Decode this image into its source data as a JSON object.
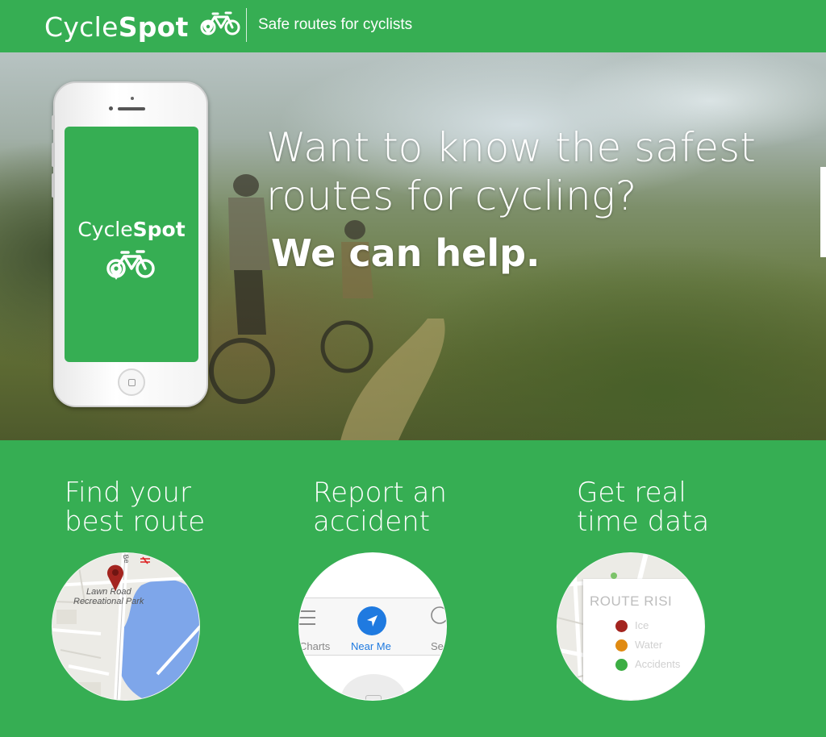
{
  "header": {
    "brand_light": "Cycle",
    "brand_bold": "Spot",
    "tagline": "Safe routes for cyclists",
    "icon": "bike-pin-icon"
  },
  "hero": {
    "question_line1": "Want to know the safest",
    "question_line2": "routes for cycling?",
    "answer": "We can help.",
    "phone_brand_light": "Cycle",
    "phone_brand_bold": "Spot"
  },
  "features": [
    {
      "title_line1": "Find your",
      "title_line2": "best route",
      "map_label_line1": "Lawn Road",
      "map_label_line2": "Recreational Park",
      "road_label": "Be"
    },
    {
      "title_line1": "Report an",
      "title_line2": "accident",
      "nav_left": "Charts",
      "nav_center": "Near Me",
      "nav_right": "Se"
    },
    {
      "title_line1": "Get real",
      "title_line2": "time data",
      "legend_title": "ROUTE RISI",
      "legend": [
        {
          "label": "Ice",
          "color": "#a3241f"
        },
        {
          "label": "Water",
          "color": "#e08a12"
        },
        {
          "label": "Accidents",
          "color": "#3cae43"
        }
      ]
    }
  ],
  "colors": {
    "brand_green": "#36ae53",
    "near_me_blue": "#1f7ae0",
    "pin_red": "#a3241f"
  }
}
